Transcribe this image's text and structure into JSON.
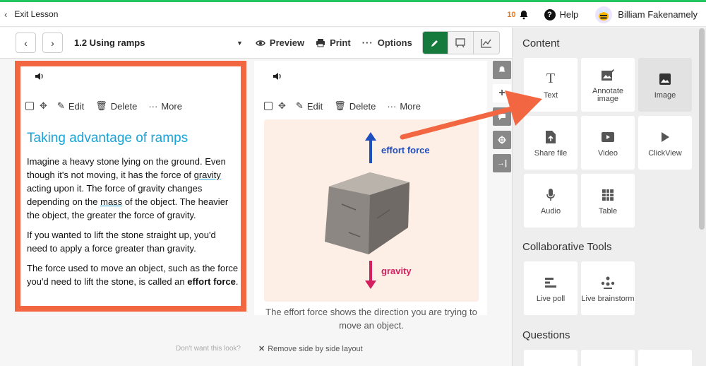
{
  "topbar": {
    "exit_label": "Exit Lesson",
    "notification_count": "10",
    "help_label": "Help",
    "user_name": "Billiam Fakenamely"
  },
  "toolbar": {
    "lesson_title": "1.2 Using ramps",
    "preview_label": "Preview",
    "print_label": "Print",
    "options_label": "Options"
  },
  "left_panel": {
    "edit_label": "Edit",
    "delete_label": "Delete",
    "more_label": "More",
    "title": "Taking advantage of ramps",
    "p1_a": "Imagine a heavy stone lying on the ground. Even though it's not moving, it has the force of ",
    "p1_link1": "gravity",
    "p1_b": " acting upon it. The force of gravity changes depending on the ",
    "p1_link2": "mass",
    "p1_c": " of the object. The heavier the object, the greater the force of gravity.",
    "p2": "If you wanted to lift the stone straight up, you'd need to apply a force greater than gravity.",
    "p3_a": "The force used to move an object, such as the force you'd need to lift the stone, is called an ",
    "p3_bold": "effort force",
    "p3_c": "."
  },
  "right_panel": {
    "edit_label": "Edit",
    "delete_label": "Delete",
    "more_label": "More",
    "effort_label": "effort force",
    "gravity_label": "gravity",
    "caption": "The effort force shows the direction you are trying to move an object."
  },
  "footer": {
    "note": "Don't want this look?",
    "remove_label": "Remove side by side layout"
  },
  "sidebar": {
    "content_heading": "Content",
    "content_tiles": [
      {
        "label": "Text",
        "icon": "text-icon"
      },
      {
        "label": "Annotate image",
        "icon": "annotate-image-icon"
      },
      {
        "label": "Image",
        "icon": "image-icon"
      },
      {
        "label": "Share file",
        "icon": "share-file-icon"
      },
      {
        "label": "Video",
        "icon": "video-icon"
      },
      {
        "label": "ClickView",
        "icon": "clickview-icon"
      },
      {
        "label": "Audio",
        "icon": "microphone-icon"
      },
      {
        "label": "Table",
        "icon": "table-icon"
      }
    ],
    "collab_heading": "Collaborative Tools",
    "collab_tiles": [
      {
        "label": "Live poll",
        "icon": "poll-icon"
      },
      {
        "label": "Live brainstorm",
        "icon": "brainstorm-icon"
      }
    ],
    "questions_heading": "Questions"
  },
  "colors": {
    "accent_green": "#157a3c",
    "highlight_orange": "#f26641",
    "title_blue": "#1aa3d8",
    "effort_blue": "#1f4fbf",
    "gravity_pink": "#d41e5e"
  }
}
